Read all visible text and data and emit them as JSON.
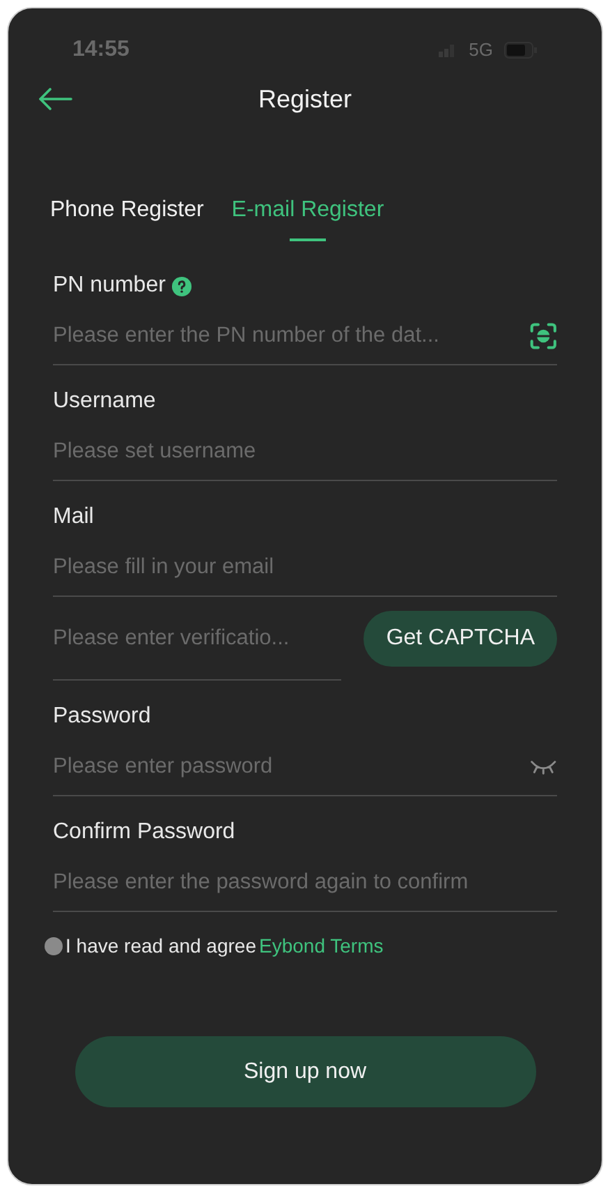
{
  "status_bar": {
    "time": "14:55",
    "network": "5G"
  },
  "header": {
    "title": "Register"
  },
  "tabs": [
    {
      "label": "Phone Register",
      "selected": false
    },
    {
      "label": "E-mail Register",
      "selected": true
    }
  ],
  "fields": [
    {
      "kind": "labeled",
      "label": "PN number",
      "help": true,
      "placeholder": "Please enter the PN number of the dat...",
      "scan_button": true
    },
    {
      "kind": "labeled",
      "label": "Username",
      "placeholder": "Please set username"
    },
    {
      "kind": "labeled",
      "label": "Mail",
      "placeholder": "Please fill in your email"
    },
    {
      "kind": "code",
      "placeholder": "Please enter verificatio...",
      "button": "Get CAPTCHA"
    },
    {
      "kind": "labeled",
      "label": "Password",
      "placeholder": "Please enter password",
      "visibility_toggle": true
    },
    {
      "kind": "labeled",
      "label": "Confirm Password",
      "placeholder": "Please enter the password again to confirm"
    }
  ],
  "agreement": {
    "checked": false,
    "text": "I have read and agree",
    "link": "Eybond Terms"
  },
  "submit": {
    "label": "Sign up now"
  }
}
